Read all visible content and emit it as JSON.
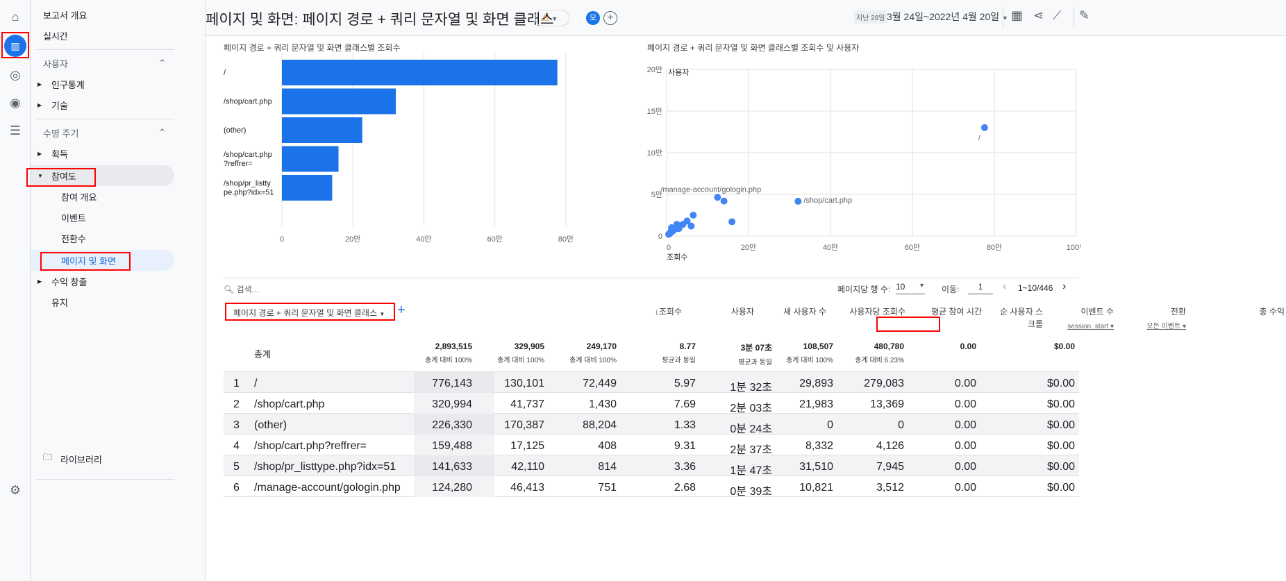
{
  "nav": {
    "items": [
      "보고서 개요",
      "실시간"
    ],
    "sections": [
      {
        "label": "사용자",
        "items": [
          "인구통계",
          "기술"
        ]
      },
      {
        "label": "수명 주기",
        "items": [
          "획득",
          "참여도",
          "수익 창출",
          "유지"
        ]
      }
    ],
    "engagement_sub": [
      "참여 개요",
      "이벤트",
      "전환수",
      "페이지 및 화면"
    ],
    "library": "라이브러리"
  },
  "header": {
    "title": "페이지 및 화면: 페이지 경로 + 쿼리 문자열 및 화면 클래스",
    "avatar": "모",
    "date_prefix": "지난 28일",
    "date_range": "3월 24일~2022년 4월 20일"
  },
  "bar_chart": {
    "title": "페이지 경로 + 쿼리 문자열 및 화면 클래스별 조회수"
  },
  "scatter_chart": {
    "title": "페이지 경로 + 쿼리 문자열 및 화면 클래스별 조회수 및 사용자"
  },
  "chart_data": [
    {
      "type": "bar",
      "title": "페이지 경로 + 쿼리 문자열 및 화면 클래스별 조회수",
      "categories": [
        "/",
        "/shop/cart.php",
        "(other)",
        "/shop/cart.php ?reffrer=",
        "/shop/pr_listty pe.php?idx=51"
      ],
      "values": [
        776143,
        320994,
        226330,
        159488,
        141633
      ],
      "xticks": [
        "0",
        "20만",
        "40만",
        "60만",
        "80만"
      ],
      "xlim": [
        0,
        900000
      ],
      "color": "#1a73e8"
    },
    {
      "type": "scatter",
      "title": "페이지 경로 + 쿼리 문자열 및 화면 클래스별 조회수 및 사용자",
      "xlabel": "조회수",
      "ylabel": "사용자",
      "xticks": [
        "0",
        "20만",
        "40만",
        "60만",
        "80만",
        "100만"
      ],
      "yticks": [
        "0",
        "5만",
        "10만",
        "15만",
        "20만"
      ],
      "xlim": [
        0,
        1000000
      ],
      "ylim": [
        0,
        200000
      ],
      "points": [
        [
          776143,
          130101,
          "/"
        ],
        [
          320994,
          41737,
          "/shop/cart.php"
        ],
        [
          124280,
          46413,
          "/manage-account/gologin.php"
        ],
        [
          140000,
          42000,
          ""
        ],
        [
          159488,
          17125,
          ""
        ],
        [
          65000,
          25000,
          ""
        ],
        [
          50000,
          18000,
          ""
        ],
        [
          40000,
          14000,
          ""
        ],
        [
          25000,
          14000,
          ""
        ],
        [
          60000,
          12000,
          ""
        ],
        [
          20000,
          8000,
          ""
        ],
        [
          15000,
          6000,
          ""
        ],
        [
          10000,
          5000,
          ""
        ],
        [
          8000,
          3000,
          ""
        ],
        [
          5000,
          2000,
          ""
        ],
        [
          30000,
          9000,
          ""
        ],
        [
          12000,
          10000,
          ""
        ]
      ]
    }
  ],
  "table": {
    "search_placeholder": "검색...",
    "rows_per_page_label": "페이지당 행 수:",
    "rows_per_page": "10",
    "goto_label": "이동:",
    "goto_value": "1",
    "range": "1~10/446",
    "dimension": "페이지 경로 + 쿼리 문자열 및 화면 클래스",
    "headers": [
      "↓조회수",
      "사용자",
      "새 사용자 수",
      "사용자당 조회수",
      "평균 참여 시간",
      "순 사용자 스크롤",
      "이벤트 수",
      "전환",
      "총 수익"
    ],
    "event_filter": "session_start",
    "conv_filter": "모든 이벤트",
    "totals_label": "총계",
    "totals": [
      "2,893,515",
      "329,905",
      "249,170",
      "8.77",
      "3분 07초",
      "108,507",
      "480,780",
      "0.00",
      "$0.00"
    ],
    "totals_sub": [
      "총계 대비 100%",
      "총계 대비 100%",
      "총계 대비 100%",
      "평균과 동일",
      "평균과 동일",
      "총계 대비 100%",
      "총계 대비 6.23%",
      "",
      ""
    ],
    "rows": [
      [
        "1",
        "/",
        "776,143",
        "130,101",
        "72,449",
        "5.97",
        "1분 32초",
        "29,893",
        "279,083",
        "0.00",
        "$0.00"
      ],
      [
        "2",
        "/shop/cart.php",
        "320,994",
        "41,737",
        "1,430",
        "7.69",
        "2분 03초",
        "21,983",
        "13,369",
        "0.00",
        "$0.00"
      ],
      [
        "3",
        "(other)",
        "226,330",
        "170,387",
        "88,204",
        "1.33",
        "0분 24초",
        "0",
        "0",
        "0.00",
        "$0.00"
      ],
      [
        "4",
        "/shop/cart.php?reffrer=",
        "159,488",
        "17,125",
        "408",
        "9.31",
        "2분 37초",
        "8,332",
        "4,126",
        "0.00",
        "$0.00"
      ],
      [
        "5",
        "/shop/pr_listtype.php?idx=51",
        "141,633",
        "42,110",
        "814",
        "3.36",
        "1분 47초",
        "31,510",
        "7,945",
        "0.00",
        "$0.00"
      ],
      [
        "6",
        "/manage-account/gologin.php",
        "124,280",
        "46,413",
        "751",
        "2.68",
        "0분 39초",
        "10,821",
        "3,512",
        "0.00",
        "$0.00"
      ]
    ]
  }
}
